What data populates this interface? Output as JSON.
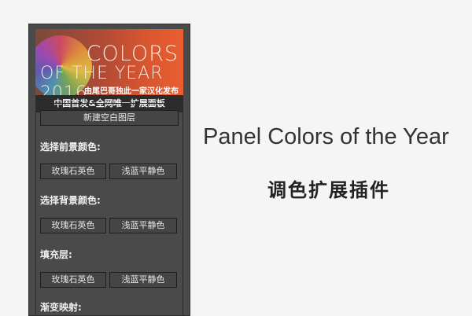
{
  "banner": {
    "title_line1": "COLORS",
    "title_line2": "OF THE YEAR 2016",
    "subtitle": "由尾巴哥独此一家汉化发布",
    "caption": "中国首发&全网唯一扩展面板"
  },
  "panel": {
    "new_layer_button": "新建空白图层",
    "sections": [
      {
        "label": "选择前景颜色:",
        "buttons": [
          "玫瑰石英色",
          "浅蓝平静色"
        ]
      },
      {
        "label": "选择背景颜色:",
        "buttons": [
          "玫瑰石英色",
          "浅蓝平静色"
        ]
      },
      {
        "label": "填充层:",
        "buttons": [
          "玫瑰石英色",
          "浅蓝平静色"
        ]
      },
      {
        "label": "渐变映射:",
        "buttons": []
      }
    ]
  },
  "headline": "Panel Colors of the Year",
  "subline": "调色扩展插件",
  "colors": {
    "panel_bg": "#4a4a4a",
    "banner_accent": "#ea5e30",
    "page_bg": "#f5f5f5"
  }
}
